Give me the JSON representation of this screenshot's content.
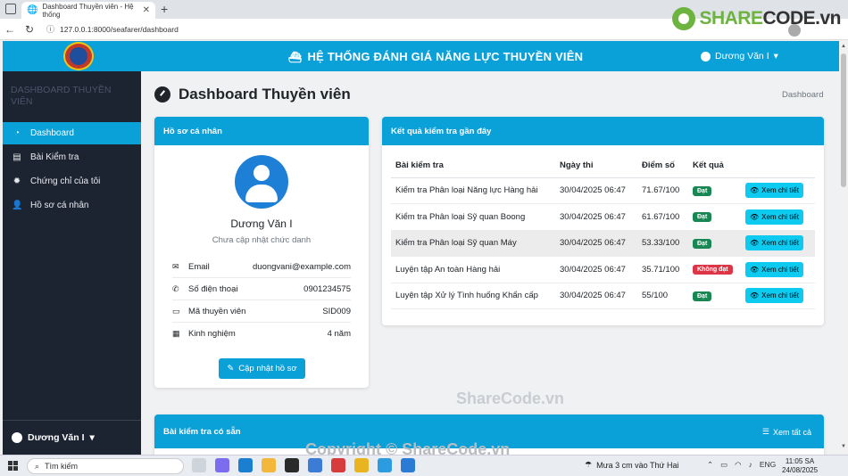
{
  "browser": {
    "tab_title": "Dashboard Thuyền viên - Hệ thống",
    "url": "127.0.0.1:8000/seafarer/dashboard",
    "watermark_brand": "SHARECODE.vn",
    "watermark_brand_green": "SHARE",
    "watermark_brand_rest": "CODE.vn"
  },
  "header": {
    "system_title": "HỆ THỐNG ĐÁNH GIÁ NĂNG LỰC THUYỀN VIÊN",
    "user_name": "Dương Văn I"
  },
  "sidebar": {
    "brand": "DASHBOARD THUYỀN VIÊN",
    "items": [
      {
        "label": "Dashboard",
        "icon": "gauge-icon",
        "active": true
      },
      {
        "label": "Bài Kiểm tra",
        "icon": "file-icon",
        "active": false
      },
      {
        "label": "Chứng chỉ của tôi",
        "icon": "certificate-icon",
        "active": false
      },
      {
        "label": "Hồ sơ cá nhân",
        "icon": "user-icon",
        "active": false
      }
    ],
    "footer_user": "Dương Văn I"
  },
  "page": {
    "title": "Dashboard Thuyền viên",
    "breadcrumb": "Dashboard"
  },
  "profile": {
    "header": "Hồ sơ cá nhân",
    "name": "Dương Văn I",
    "role": "Chưa cập nhật chức danh",
    "rows": [
      {
        "icon": "envelope-icon",
        "label": "Email",
        "value": "duongvani@example.com"
      },
      {
        "icon": "phone-icon",
        "label": "Số điện thoại",
        "value": "0901234575"
      },
      {
        "icon": "id-card-icon",
        "label": "Mã thuyền viên",
        "value": "SID009"
      },
      {
        "icon": "calendar-icon",
        "label": "Kinh nghiệm",
        "value": "4 năm"
      }
    ],
    "update_button": "Cập nhật hồ sơ"
  },
  "results": {
    "header": "Kết quả kiểm tra gần đây",
    "columns": [
      "Bài kiểm tra",
      "Ngày thi",
      "Điểm số",
      "Kết quả",
      ""
    ],
    "rows": [
      {
        "test": "Kiểm tra Phân loại Năng lực Hàng hải",
        "date": "30/04/2025 06:47",
        "score": "71.67/100",
        "result": "Đạt",
        "pass": true
      },
      {
        "test": "Kiểm tra Phân loại Sỹ quan Boong",
        "date": "30/04/2025 06:47",
        "score": "61.67/100",
        "result": "Đạt",
        "pass": true
      },
      {
        "test": "Kiểm tra Phân loại Sỹ quan Máy",
        "date": "30/04/2025 06:47",
        "score": "53.33/100",
        "result": "Đạt",
        "pass": true
      },
      {
        "test": "Luyện tập An toàn Hàng hải",
        "date": "30/04/2025 06:47",
        "score": "35.71/100",
        "result": "Không đạt",
        "pass": false
      },
      {
        "test": "Luyện tập Xử lý Tình huống Khẩn cấp",
        "date": "30/04/2025 06:47",
        "score": "55/100",
        "result": "Đạt",
        "pass": true
      }
    ],
    "view_label": "Xem chi tiết"
  },
  "available": {
    "header": "Bài kiểm tra có sẵn",
    "view_all": "Xem tất cả"
  },
  "watermarks": {
    "center": "ShareCode.vn",
    "copyright": "Copyright © ShareCode.vn"
  },
  "taskbar": {
    "search_placeholder": "Tìm kiếm",
    "weather": "Mưa 3 cm vào Thứ Hai",
    "lang": "ENG",
    "time": "11:05 SA",
    "date": "24/08/2025"
  },
  "colors": {
    "primary": "#0aa0d8",
    "sidebar": "#1c2331",
    "success": "#198754",
    "danger": "#dc3545",
    "info": "#0dcaf0"
  }
}
